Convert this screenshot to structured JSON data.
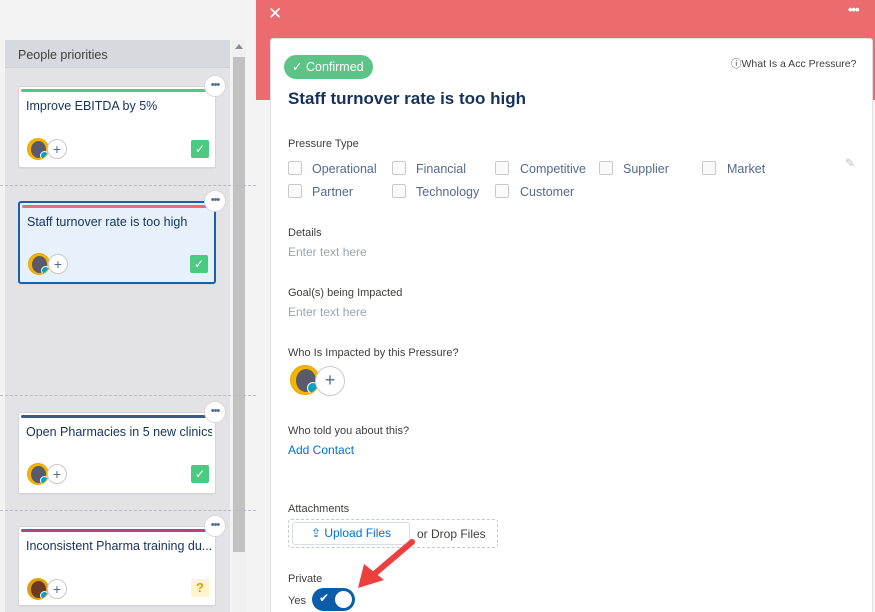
{
  "board": {
    "column_title": "People priorities",
    "cards": [
      {
        "title": "Improve EBITDA by 5%",
        "bar_color": "#4bca81",
        "status": "check"
      },
      {
        "title": "Staff turnover rate is too high",
        "bar_color": "#ec6b6f",
        "status": "check",
        "selected": true
      },
      {
        "title": "Open Pharmacies in 5 new clinics",
        "bar_color": "#3e5a80",
        "status": "check"
      },
      {
        "title": "Inconsistent Pharma training du...",
        "bar_color": "#b7417f",
        "status": "question"
      }
    ]
  },
  "detail": {
    "status_label": "Confirmed",
    "help_link": "What Is a Acc Pressure?",
    "title": "Staff turnover rate is too high",
    "pressure_type_label": "Pressure Type",
    "pressure_types": [
      "Operational",
      "Financial",
      "Competitive",
      "Supplier",
      "Market",
      "Partner",
      "Technology",
      "Customer"
    ],
    "details_label": "Details",
    "details_placeholder": "Enter text here",
    "goals_label": "Goal(s) being Impacted",
    "goals_placeholder": "Enter text here",
    "impacted_label": "Who Is Impacted by this Pressure?",
    "told_label": "Who told you about this?",
    "add_contact": "Add Contact",
    "attachments_label": "Attachments",
    "upload_label": "Upload Files",
    "drop_label": "or Drop Files",
    "private_label": "Private",
    "private_value": "Yes"
  },
  "colors": {
    "header": "#ec6b6f",
    "confirmed": "#5dc487",
    "toggle": "#0b5cab",
    "link": "#0070d2",
    "annotation_arrow": "#ee3f3f"
  },
  "icons": {
    "close": "close-icon",
    "more": "more-icon",
    "info": "info-icon",
    "edit": "pencil-icon",
    "upload": "upload-icon"
  }
}
